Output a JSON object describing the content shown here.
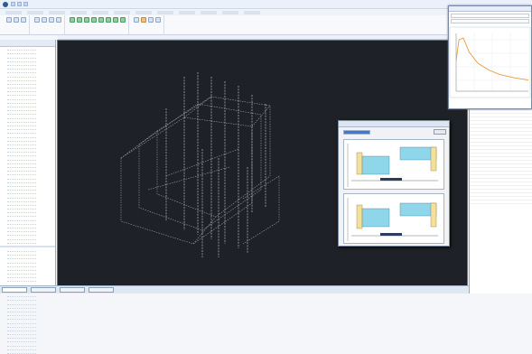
{
  "window": {
    "title": ""
  },
  "menu": {
    "items": [
      "",
      "",
      "",
      "",
      "",
      "",
      "",
      "",
      "",
      "",
      "",
      ""
    ]
  },
  "ribbon": {
    "groups": [
      {
        "label": "",
        "buttons": [
          "b",
          "b",
          "b"
        ]
      },
      {
        "label": "",
        "buttons": [
          "b",
          "b",
          "b",
          "b"
        ]
      },
      {
        "label": "",
        "buttons": [
          "g",
          "g",
          "g",
          "g",
          "g",
          "g",
          "g",
          "g"
        ]
      },
      {
        "label": "",
        "buttons": [
          "b",
          "o",
          "b",
          "b"
        ]
      }
    ]
  },
  "tree": {
    "header": "",
    "item_count_top": 52,
    "item_count_bottom": 28
  },
  "graph_window": {
    "title": "",
    "fields": [
      "",
      ""
    ],
    "chart_title": "",
    "curve": [
      [
        0,
        0.55
      ],
      [
        0.04,
        0.92
      ],
      [
        0.1,
        0.95
      ],
      [
        0.18,
        0.7
      ],
      [
        0.3,
        0.5
      ],
      [
        0.45,
        0.38
      ],
      [
        0.6,
        0.3
      ],
      [
        0.8,
        0.24
      ],
      [
        1,
        0.2
      ]
    ]
  },
  "dialog": {
    "title": "",
    "name_label": "",
    "name_value": "",
    "button_label": ""
  },
  "properties": {
    "header": "",
    "rows": 44
  },
  "statusbar": {
    "tabs": [
      "",
      "",
      "",
      ""
    ]
  },
  "colors": {
    "viewport_bg": "#1e2127",
    "wireframe": "#9aa0a8",
    "beam_fill": "#8fd6ea",
    "beam_end": "#f3e19a"
  }
}
